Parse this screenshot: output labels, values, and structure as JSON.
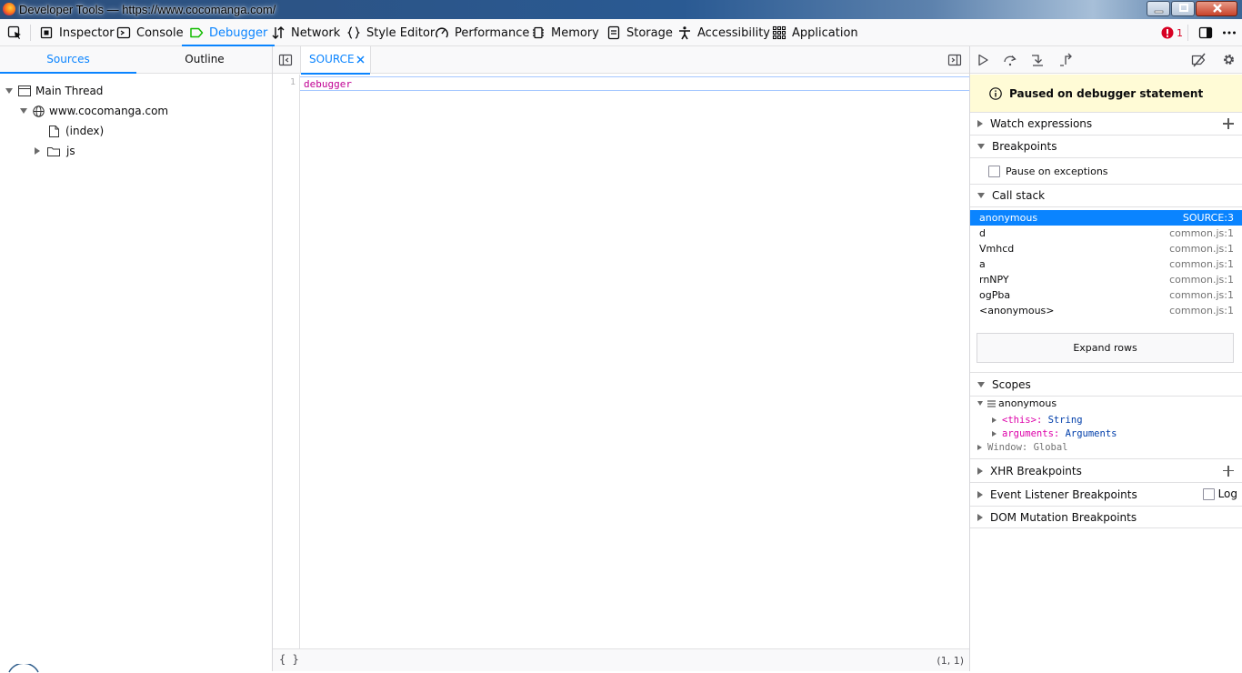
{
  "window": {
    "title": "Developer Tools — https://www.cocomanga.com/"
  },
  "toolbar": {
    "tabs": [
      {
        "label": "Inspector",
        "icon": "inspector-icon"
      },
      {
        "label": "Console",
        "icon": "console-icon"
      },
      {
        "label": "Debugger",
        "icon": "debugger-icon",
        "selected": true
      },
      {
        "label": "Network",
        "icon": "network-icon"
      },
      {
        "label": "Style Editor",
        "icon": "style-editor-icon"
      },
      {
        "label": "Performance",
        "icon": "performance-icon"
      },
      {
        "label": "Memory",
        "icon": "memory-icon"
      },
      {
        "label": "Storage",
        "icon": "storage-icon"
      },
      {
        "label": "Accessibility",
        "icon": "accessibility-icon"
      },
      {
        "label": "Application",
        "icon": "application-icon"
      }
    ],
    "error_count": "1",
    "accent": "#0a84ff",
    "error_color": "#d70022"
  },
  "sources": {
    "tabs": [
      {
        "label": "Sources",
        "selected": true
      },
      {
        "label": "Outline"
      }
    ],
    "tree": {
      "thread": "Main Thread",
      "domain": "www.cocomanga.com",
      "index": "(index)",
      "folder": "js"
    }
  },
  "editor": {
    "tab_label": "SOURCE",
    "line_number": "1",
    "code": "debugger",
    "pretty_print": "{ }",
    "cursor": "(1, 1)"
  },
  "debug": {
    "paused_message": "Paused on debugger statement",
    "watch": "Watch expressions",
    "breakpoints": "Breakpoints",
    "pause_exceptions": "Pause on exceptions",
    "call_stack": "Call stack",
    "frames": [
      {
        "name": "anonymous",
        "loc": "SOURCE:3"
      },
      {
        "name": "d",
        "loc": "common.js:1"
      },
      {
        "name": "Vmhcd",
        "loc": "common.js:1"
      },
      {
        "name": "a",
        "loc": "common.js:1"
      },
      {
        "name": "rnNPY",
        "loc": "common.js:1"
      },
      {
        "name": "ogPba",
        "loc": "common.js:1"
      },
      {
        "name": "<anonymous>",
        "loc": "common.js:1"
      }
    ],
    "expand_rows": "Expand rows",
    "scopes": "Scopes",
    "scope_name": "anonymous",
    "scope_this_key": "<this>",
    "scope_this_val": "String",
    "scope_args_key": "arguments",
    "scope_args_val": "Arguments",
    "scope_window": "Window: Global",
    "xhr": "XHR Breakpoints",
    "event_listener": "Event Listener Breakpoints",
    "log": "Log",
    "dom_mutation": "DOM Mutation Breakpoints"
  }
}
